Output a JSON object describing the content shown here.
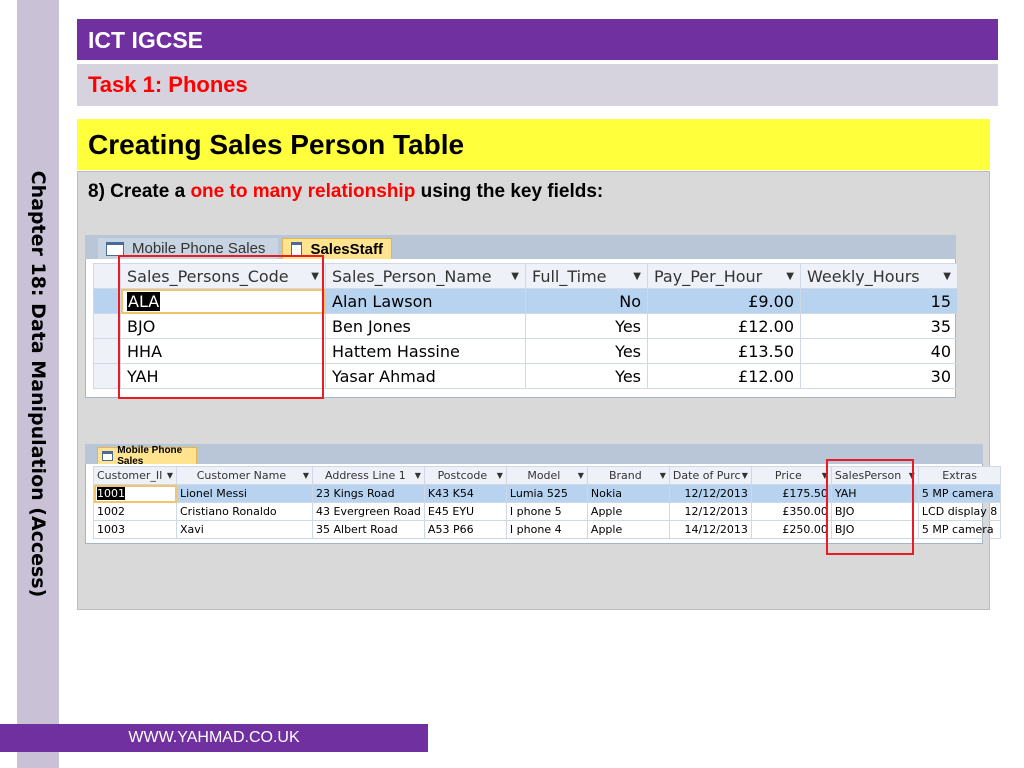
{
  "side_label": "Chapter 18: Data Manipulation (Access)",
  "header": {
    "title": "ICT IGCSE"
  },
  "subheader": {
    "title": "Task 1: Phones"
  },
  "heading": "Creating Sales Person Table",
  "instruction": {
    "prefix": "8) Create a ",
    "highlight": "one to many relationship",
    "suffix": " using the key fields:"
  },
  "sales_staff": {
    "tabs": [
      "Mobile Phone Sales",
      "SalesStaff"
    ],
    "columns": [
      "Sales_Persons_Code",
      "Sales_Person_Name",
      "Full_Time",
      "Pay_Per_Hour",
      "Weekly_Hours"
    ],
    "rows": [
      [
        "ALA",
        "Alan Lawson",
        "No",
        "£9.00",
        "15"
      ],
      [
        "BJO",
        "Ben Jones",
        "Yes",
        "£12.00",
        "35"
      ],
      [
        "HHA",
        "Hattem Hassine",
        "Yes",
        "£13.50",
        "40"
      ],
      [
        "YAH",
        "Yasar Ahmad",
        "Yes",
        "£12.00",
        "30"
      ]
    ]
  },
  "mobile_sales": {
    "tab": "Mobile Phone Sales",
    "columns": [
      "Customer_II",
      "Customer Name",
      "Address Line 1",
      "Postcode",
      "Model",
      "Brand",
      "Date of Purc",
      "Price",
      "SalesPerson",
      "Extras"
    ],
    "rows": [
      [
        "1001",
        "Lionel Messi",
        "23 Kings Road",
        "K43 K54",
        "Lumia 525",
        "Nokia",
        "12/12/2013",
        "£175.50",
        "YAH",
        "5 MP camera"
      ],
      [
        "1002",
        "Cristiano Ronaldo",
        "43 Evergreen Road",
        "E45 EYU",
        "I phone 5",
        "Apple",
        "12/12/2013",
        "£350.00",
        "BJO",
        "LCD display 8"
      ],
      [
        "1003",
        "Xavi",
        "35 Albert Road",
        "A53 P66",
        "I phone 4",
        "Apple",
        "14/12/2013",
        "£250.00",
        "BJO",
        "5 MP camera"
      ]
    ]
  },
  "footer": "WWW.YAHMAD.CO.UK"
}
